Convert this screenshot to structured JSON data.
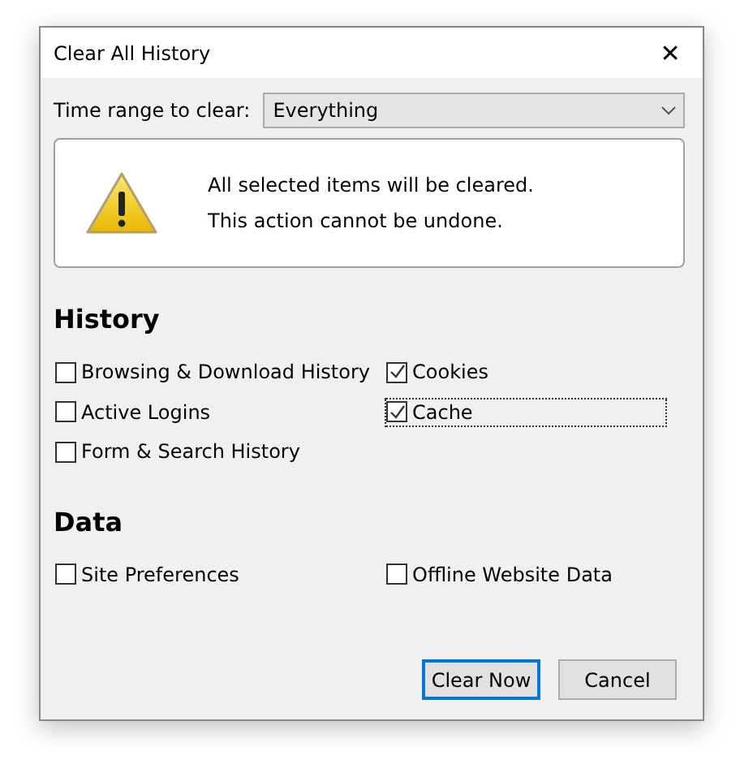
{
  "window": {
    "title": "Clear All History",
    "close": "✕"
  },
  "time_range": {
    "label": "Time range to clear:",
    "value": "Everything"
  },
  "warning": {
    "lines": [
      "All selected items will be cleared.",
      "This action cannot be undone."
    ]
  },
  "sections": [
    {
      "title": "History",
      "items": [
        {
          "label": "Browsing & Download History",
          "checked": false,
          "focused": false
        },
        {
          "label": "Cookies",
          "checked": true,
          "focused": false
        },
        {
          "label": "Active Logins",
          "checked": false,
          "focused": false
        },
        {
          "label": "Cache",
          "checked": true,
          "focused": true
        },
        {
          "label": "Form & Search History",
          "checked": false,
          "focused": false
        }
      ]
    },
    {
      "title": "Data",
      "items": [
        {
          "label": "Site Preferences",
          "checked": false,
          "focused": false
        },
        {
          "label": "Offline Website Data",
          "checked": false,
          "focused": false
        }
      ]
    }
  ],
  "buttons": [
    {
      "label": "Clear Now",
      "default": true
    },
    {
      "label": "Cancel",
      "default": false
    }
  ]
}
